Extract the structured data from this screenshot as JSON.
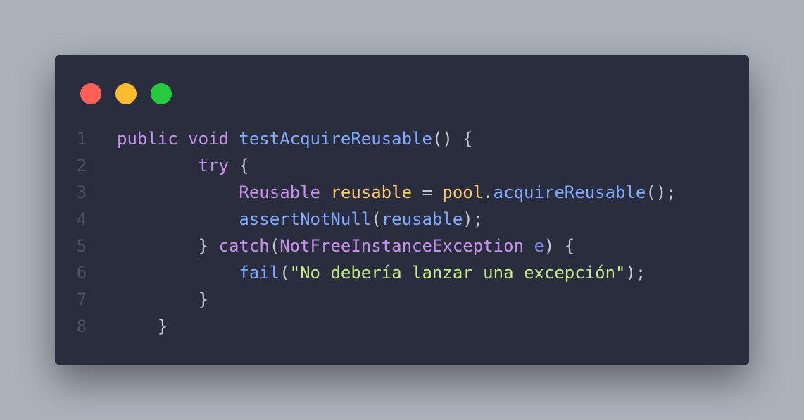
{
  "colors": {
    "background": "#aab2bb",
    "window": "#292d3e",
    "line_number": "#4b5263",
    "keyword": "#c792ea",
    "function": "#82aaff",
    "variable": "#ffcb6b",
    "type": "#c792ea",
    "punctuation": "#bfc7d5",
    "string": "#c3e88d",
    "parameter": "#7986e7"
  },
  "window_controls": [
    {
      "name": "close",
      "color": "#ff5f56"
    },
    {
      "name": "minimize",
      "color": "#ffbd2e"
    },
    {
      "name": "maximize",
      "color": "#27c93f"
    }
  ],
  "code": {
    "lines": [
      {
        "number": "1",
        "indent": "",
        "tokens": [
          {
            "text": "public",
            "kind": "keyword"
          },
          {
            "text": " ",
            "kind": "punctuation"
          },
          {
            "text": "void",
            "kind": "keyword"
          },
          {
            "text": " ",
            "kind": "punctuation"
          },
          {
            "text": "testAcquireReusable",
            "kind": "function"
          },
          {
            "text": "() {",
            "kind": "punctuation"
          }
        ]
      },
      {
        "number": "2",
        "indent": "        ",
        "tokens": [
          {
            "text": "try",
            "kind": "keyword"
          },
          {
            "text": " {",
            "kind": "punctuation"
          }
        ]
      },
      {
        "number": "3",
        "indent": "            ",
        "tokens": [
          {
            "text": "Reusable",
            "kind": "type"
          },
          {
            "text": " ",
            "kind": "punctuation"
          },
          {
            "text": "reusable",
            "kind": "variable"
          },
          {
            "text": " = ",
            "kind": "punctuation"
          },
          {
            "text": "pool",
            "kind": "variable"
          },
          {
            "text": ".",
            "kind": "punctuation"
          },
          {
            "text": "acquireReusable",
            "kind": "function"
          },
          {
            "text": "();",
            "kind": "punctuation"
          }
        ]
      },
      {
        "number": "4",
        "indent": "            ",
        "tokens": [
          {
            "text": "assertNotNull",
            "kind": "function"
          },
          {
            "text": "(",
            "kind": "punctuation"
          },
          {
            "text": "reusable",
            "kind": "function"
          },
          {
            "text": ");",
            "kind": "punctuation"
          }
        ]
      },
      {
        "number": "5",
        "indent": "        ",
        "tokens": [
          {
            "text": "} ",
            "kind": "punctuation"
          },
          {
            "text": "catch",
            "kind": "keyword"
          },
          {
            "text": "(",
            "kind": "punctuation"
          },
          {
            "text": "NotFreeInstanceException",
            "kind": "type"
          },
          {
            "text": " ",
            "kind": "punctuation"
          },
          {
            "text": "e",
            "kind": "parameter"
          },
          {
            "text": ") {",
            "kind": "punctuation"
          }
        ]
      },
      {
        "number": "6",
        "indent": "            ",
        "tokens": [
          {
            "text": "fail",
            "kind": "function"
          },
          {
            "text": "(",
            "kind": "punctuation"
          },
          {
            "text": "\"No debería lanzar una excepción\"",
            "kind": "string"
          },
          {
            "text": ");",
            "kind": "punctuation"
          }
        ]
      },
      {
        "number": "7",
        "indent": "        ",
        "tokens": [
          {
            "text": "}",
            "kind": "punctuation"
          }
        ]
      },
      {
        "number": "8",
        "indent": "    ",
        "tokens": [
          {
            "text": "}",
            "kind": "punctuation"
          }
        ]
      }
    ]
  }
}
